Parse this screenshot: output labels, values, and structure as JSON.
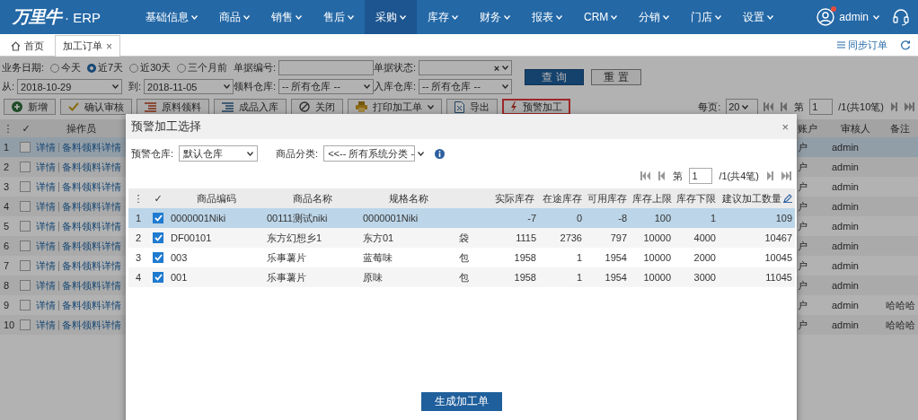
{
  "nav": {
    "logo": "万里牛",
    "logo_suffix": "· ERP",
    "user": "admin",
    "notification": true,
    "menu": [
      {
        "label": "基础信息",
        "selected": false
      },
      {
        "label": "商品",
        "selected": false
      },
      {
        "label": "销售",
        "selected": false
      },
      {
        "label": "售后",
        "selected": false
      },
      {
        "label": "采购",
        "selected": true
      },
      {
        "label": "库存",
        "selected": false
      },
      {
        "label": "财务",
        "selected": false
      },
      {
        "label": "报表",
        "selected": false
      },
      {
        "label": "CRM",
        "selected": false
      },
      {
        "label": "分销",
        "selected": false
      },
      {
        "label": "门店",
        "selected": false
      },
      {
        "label": "设置",
        "selected": false
      }
    ]
  },
  "tabs": [
    {
      "label": "首页",
      "selected": false,
      "kind": "home"
    },
    {
      "label": "加工订单",
      "selected": true,
      "kind": "closable",
      "close": "×"
    }
  ],
  "sync_link": "同步订单",
  "filters": {
    "date_label": "业务日期:",
    "date_options": [
      {
        "label": "今天",
        "selected": false
      },
      {
        "label": "近7天",
        "selected": true
      },
      {
        "label": "近30天",
        "selected": false
      },
      {
        "label": "三个月前",
        "selected": false
      }
    ],
    "doc_no_label": "单据编号:",
    "status_label": "单据状态:",
    "status_clear": "×",
    "from_label": "从:",
    "from": "2018-10-29",
    "to_label": "到:",
    "to": "2018-11-05",
    "pick_wh_label": "领料仓库:",
    "pick_wh": "-- 所有仓库 --",
    "in_wh_label": "入库仓库:",
    "in_wh": "-- 所有仓库 --",
    "search": "查 询",
    "reset": "重 置"
  },
  "toolbar": [
    {
      "label": "新增",
      "dropdown": false,
      "highlighted": false
    },
    {
      "label": "确认审核",
      "dropdown": false,
      "highlighted": false
    },
    {
      "label": "原料领料",
      "dropdown": false,
      "highlighted": false
    },
    {
      "label": "成品入库",
      "dropdown": false,
      "highlighted": false
    },
    {
      "label": "关闭",
      "dropdown": false,
      "highlighted": false
    },
    {
      "label": "打印加工单",
      "dropdown": true,
      "highlighted": false
    },
    {
      "label": "导出",
      "dropdown": false,
      "highlighted": false
    },
    {
      "label": "预警加工",
      "dropdown": false,
      "highlighted": true
    }
  ],
  "pager": {
    "per_page_label": "每页:",
    "per_page": "20",
    "page_label": "第",
    "page": "1",
    "total": "/1(共10笔)"
  },
  "table": {
    "columns": [
      "⋮",
      "✓",
      "操作员",
      "账户",
      "审核人",
      "备注"
    ],
    "rows": [
      {
        "num": "1",
        "selected": true,
        "links": [
          "详情",
          "备料领料详情"
        ],
        "account": "户",
        "reviewer": "admin"
      },
      {
        "num": "2",
        "selected": false,
        "links": [
          "详情",
          "备料领料详情"
        ],
        "account": "户",
        "reviewer": "admin"
      },
      {
        "num": "3",
        "selected": false,
        "links": [
          "详情",
          "备料领料详情"
        ],
        "account": "户",
        "reviewer": "admin"
      },
      {
        "num": "4",
        "selected": false,
        "links": [
          "详情",
          "备料领料详情"
        ],
        "account": "户",
        "reviewer": "admin"
      },
      {
        "num": "5",
        "selected": false,
        "links": [
          "详情",
          "备料领料详情"
        ],
        "account": "户",
        "reviewer": "admin"
      },
      {
        "num": "6",
        "selected": false,
        "links": [
          "详情",
          "备料领料详情"
        ],
        "account": "户",
        "reviewer": "admin"
      },
      {
        "num": "7",
        "selected": false,
        "links": [
          "详情",
          "备料领料详情"
        ],
        "account": "户",
        "reviewer": "admin"
      },
      {
        "num": "8",
        "selected": false,
        "links": [
          "详情",
          "备料领料详情"
        ],
        "account": "户",
        "reviewer": "admin"
      },
      {
        "num": "9",
        "selected": false,
        "links": [
          "详情",
          "备料领料详情"
        ],
        "account": "户",
        "reviewer": "admin",
        "note": "哈哈哈"
      },
      {
        "num": "10",
        "selected": false,
        "links": [
          "详情",
          "备料领料详情"
        ],
        "account": "户",
        "reviewer": "admin",
        "note": "哈哈哈"
      }
    ]
  },
  "modal": {
    "title": "预警加工选择",
    "close": "×",
    "warehouse_label": "预警仓库:",
    "warehouse": "默认仓库",
    "category_label": "商品分类:",
    "category": "<<-- 所有系统分类 -",
    "pager": {
      "page_label": "第",
      "page": "1",
      "total": "/1(共4笔)"
    },
    "index_header": "⋮",
    "check_header": "✓",
    "columns": [
      "商品编码",
      "商品名称",
      "规格名称",
      "",
      "实际库存",
      "在途库存",
      "可用库存",
      "库存上限",
      "库存下限",
      "建议加工数量"
    ],
    "rows": [
      {
        "num": "1",
        "selected": true,
        "checked": true,
        "cells": [
          "0000001Niki",
          "00111测试niki",
          "0000001Niki",
          "",
          "-7",
          "0",
          "-8",
          "100",
          "1",
          "109"
        ]
      },
      {
        "num": "2",
        "selected": false,
        "checked": true,
        "cells": [
          "DF00101",
          "东方幻想乡1",
          "东方01",
          "袋",
          "1115",
          "2736",
          "797",
          "10000",
          "4000",
          "10467"
        ]
      },
      {
        "num": "3",
        "selected": false,
        "checked": true,
        "cells": [
          "003",
          "乐事薯片",
          "蓝莓味",
          "包",
          "1958",
          "1",
          "1954",
          "10000",
          "2000",
          "10045"
        ]
      },
      {
        "num": "4",
        "selected": false,
        "checked": true,
        "cells": [
          "001",
          "乐事薯片",
          "原味",
          "包",
          "1958",
          "1",
          "1954",
          "10000",
          "3000",
          "11045"
        ]
      }
    ],
    "action": "生成加工单"
  }
}
